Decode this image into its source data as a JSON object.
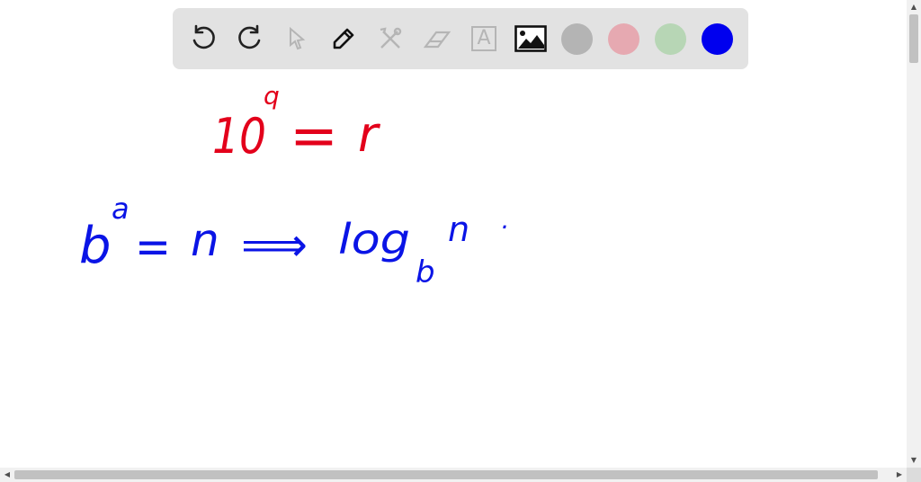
{
  "toolbar": {
    "tools": [
      {
        "name": "undo-icon",
        "state": "enabled"
      },
      {
        "name": "redo-icon",
        "state": "enabled"
      },
      {
        "name": "select-pointer-icon",
        "state": "disabled"
      },
      {
        "name": "pen-icon",
        "state": "active"
      },
      {
        "name": "tools-icon",
        "state": "disabled"
      },
      {
        "name": "eraser-icon",
        "state": "disabled"
      },
      {
        "name": "text-icon",
        "state": "disabled",
        "glyph": "A"
      },
      {
        "name": "image-icon",
        "state": "enabled"
      }
    ],
    "colors": [
      "#b4b4b4",
      "#e6a9b1",
      "#b7d6b5",
      "#0000ee"
    ]
  },
  "board": {
    "red_color": "#e3001b",
    "blue_color": "#0a14e6",
    "line1": {
      "base": "10",
      "exponent": "q",
      "equals": "=",
      "result": "r"
    },
    "line2": {
      "base": "b",
      "exponent": "a",
      "equals": "=",
      "result": "n",
      "implies": "⟹",
      "log": "log",
      "log_base": "b",
      "log_arg": "n",
      "dot": "·"
    }
  },
  "scrollbars": {
    "up": "▲",
    "down": "▼",
    "left": "◀",
    "right": "▶"
  }
}
